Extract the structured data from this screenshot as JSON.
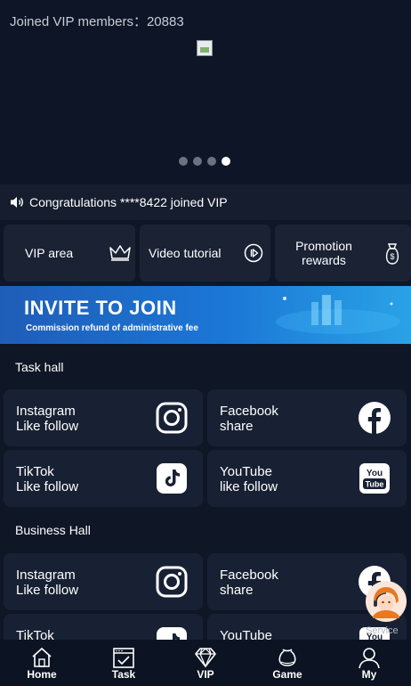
{
  "banner": {
    "vip_count_text": "Joined VIP members：20883",
    "active_dot": 4,
    "dot_count": 4
  },
  "notice": {
    "text": "Congratulations ****8422 joined VIP"
  },
  "quick_links": [
    {
      "label": "VIP area",
      "icon": "crown-icon"
    },
    {
      "label": "Video tutorial",
      "icon": "play-circle-icon"
    },
    {
      "label": "Promotion rewards",
      "icon": "money-bag-icon"
    }
  ],
  "invite_banner": {
    "title": "INVITE TO JOIN",
    "subtitle": "Commission refund of administrative fee"
  },
  "task_hall": {
    "title": "Task hall",
    "cards": [
      {
        "line1": "Instagram",
        "line2": "Like follow",
        "icon": "instagram-icon"
      },
      {
        "line1": "Facebook",
        "line2": "share",
        "icon": "facebook-icon"
      },
      {
        "line1": "TikTok",
        "line2": "Like follow",
        "icon": "tiktok-icon"
      },
      {
        "line1": "YouTube",
        "line2": "like follow",
        "icon": "youtube-icon"
      }
    ]
  },
  "business_hall": {
    "title": "Business Hall",
    "cards": [
      {
        "line1": "Instagram",
        "line2": "Like follow",
        "icon": "instagram-icon"
      },
      {
        "line1": "Facebook",
        "line2": "share",
        "icon": "facebook-icon"
      },
      {
        "line1": "TikTok",
        "line2": "",
        "icon": "tiktok-icon"
      },
      {
        "line1": "YouTube",
        "line2": "",
        "icon": "youtube-icon"
      }
    ]
  },
  "service": {
    "label": "Service"
  },
  "tabbar": [
    {
      "label": "Home",
      "icon": "home-icon"
    },
    {
      "label": "Task",
      "icon": "task-icon"
    },
    {
      "label": "VIP",
      "icon": "diamond-icon"
    },
    {
      "label": "Game",
      "icon": "game-icon"
    },
    {
      "label": "My",
      "icon": "user-icon"
    }
  ],
  "colors": {
    "background": "#0f1626",
    "card": "#182133",
    "invite_gradient_start": "#1f5db8",
    "invite_gradient_end": "#2aa2e6"
  }
}
